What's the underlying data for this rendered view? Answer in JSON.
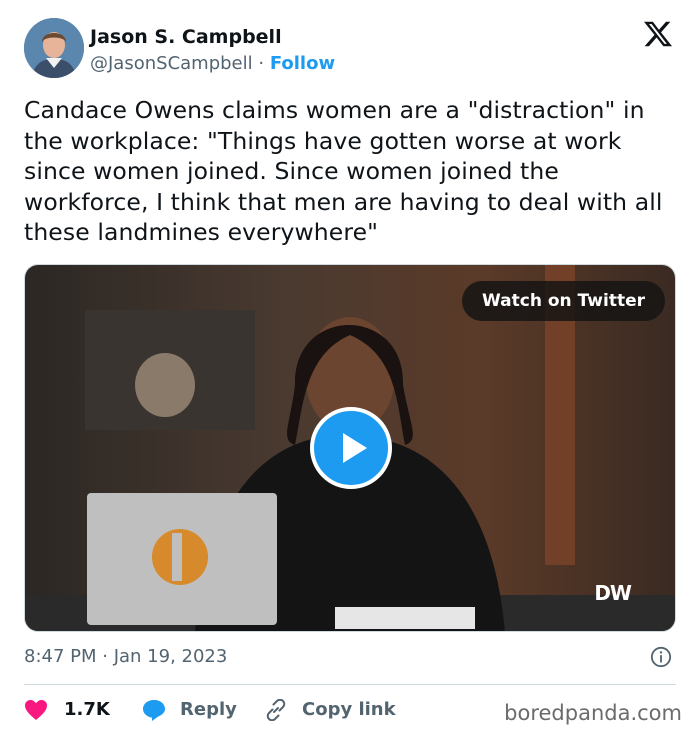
{
  "author": {
    "display_name": "Jason S. Campbell",
    "handle": "@JasonSCampbell",
    "separator": "·",
    "follow_label": "Follow"
  },
  "tweet": {
    "text": "Candace Owens claims women are a \"distraction\" in the workplace: \"Things have gotten worse at work since women joined. Since women joined the workforce, I think that men are having to deal with all these landmines everywhere\""
  },
  "media": {
    "watch_label": "Watch on Twitter",
    "channel_logo": "DW"
  },
  "meta": {
    "timestamp": "8:47 PM · Jan 19, 2023"
  },
  "actions": {
    "like_count": "1.7K",
    "reply_label": "Reply",
    "copy_link_label": "Copy link"
  },
  "watermark": "boredpanda.com",
  "colors": {
    "accent": "#1d9bf0",
    "like": "#f91880",
    "text": "#0f1419",
    "muted": "#536471"
  }
}
